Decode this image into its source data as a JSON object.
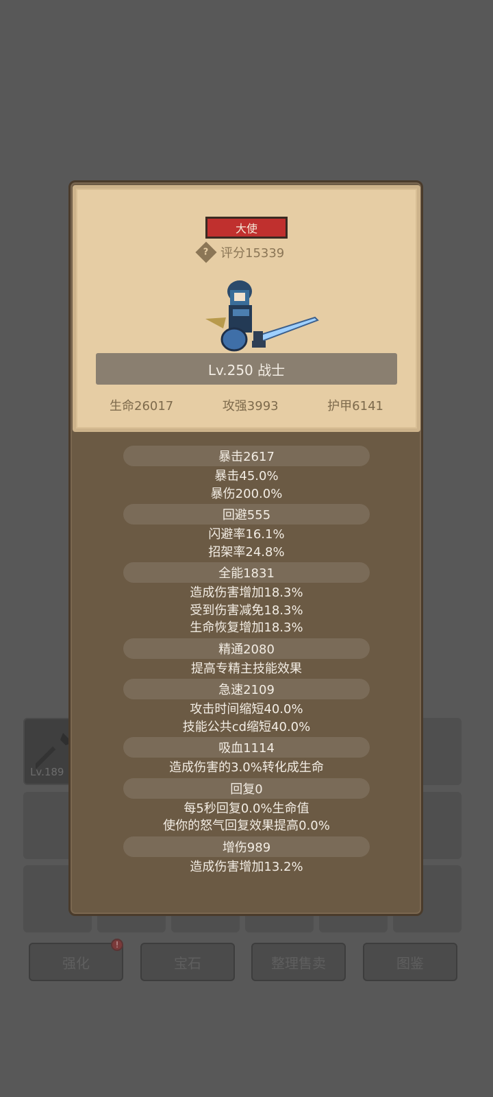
{
  "inventory": {
    "first_item_level": "Lv.189"
  },
  "bottom_buttons": [
    {
      "label": "强化",
      "badge": "!"
    },
    {
      "label": "宝石"
    },
    {
      "label": "整理售卖"
    },
    {
      "label": "图鉴"
    }
  ],
  "character": {
    "title": "大使",
    "score": "评分15339",
    "level_class": "Lv.250 战士",
    "hp": "生命26017",
    "attack": "攻强3993",
    "armor": "护甲6141"
  },
  "stats": [
    {
      "header": "暴击2617",
      "lines": [
        "暴击45.0%",
        "暴伤200.0%"
      ]
    },
    {
      "header": "回避555",
      "lines": [
        "闪避率16.1%",
        "招架率24.8%"
      ]
    },
    {
      "header": "全能1831",
      "lines": [
        "造成伤害增加18.3%",
        "受到伤害减免18.3%",
        "生命恢复增加18.3%"
      ]
    },
    {
      "header": "精通2080",
      "lines": [
        "提高专精主技能效果"
      ]
    },
    {
      "header": "急速2109",
      "lines": [
        "攻击时间缩短40.0%",
        "技能公共cd缩短40.0%"
      ]
    },
    {
      "header": "吸血1114",
      "lines": [
        "造成伤害的3.0%转化成生命"
      ]
    },
    {
      "header": "回复0",
      "lines": [
        "每5秒回复0.0%生命值",
        "使你的怒气回复效果提高0.0%"
      ]
    },
    {
      "header": "增伤989",
      "lines": [
        "造成伤害增加13.2%"
      ]
    }
  ],
  "colors": {
    "badge_red": "#c0302e",
    "card_parchment": "#e6cda4",
    "modal_brown": "#6b5a44"
  }
}
